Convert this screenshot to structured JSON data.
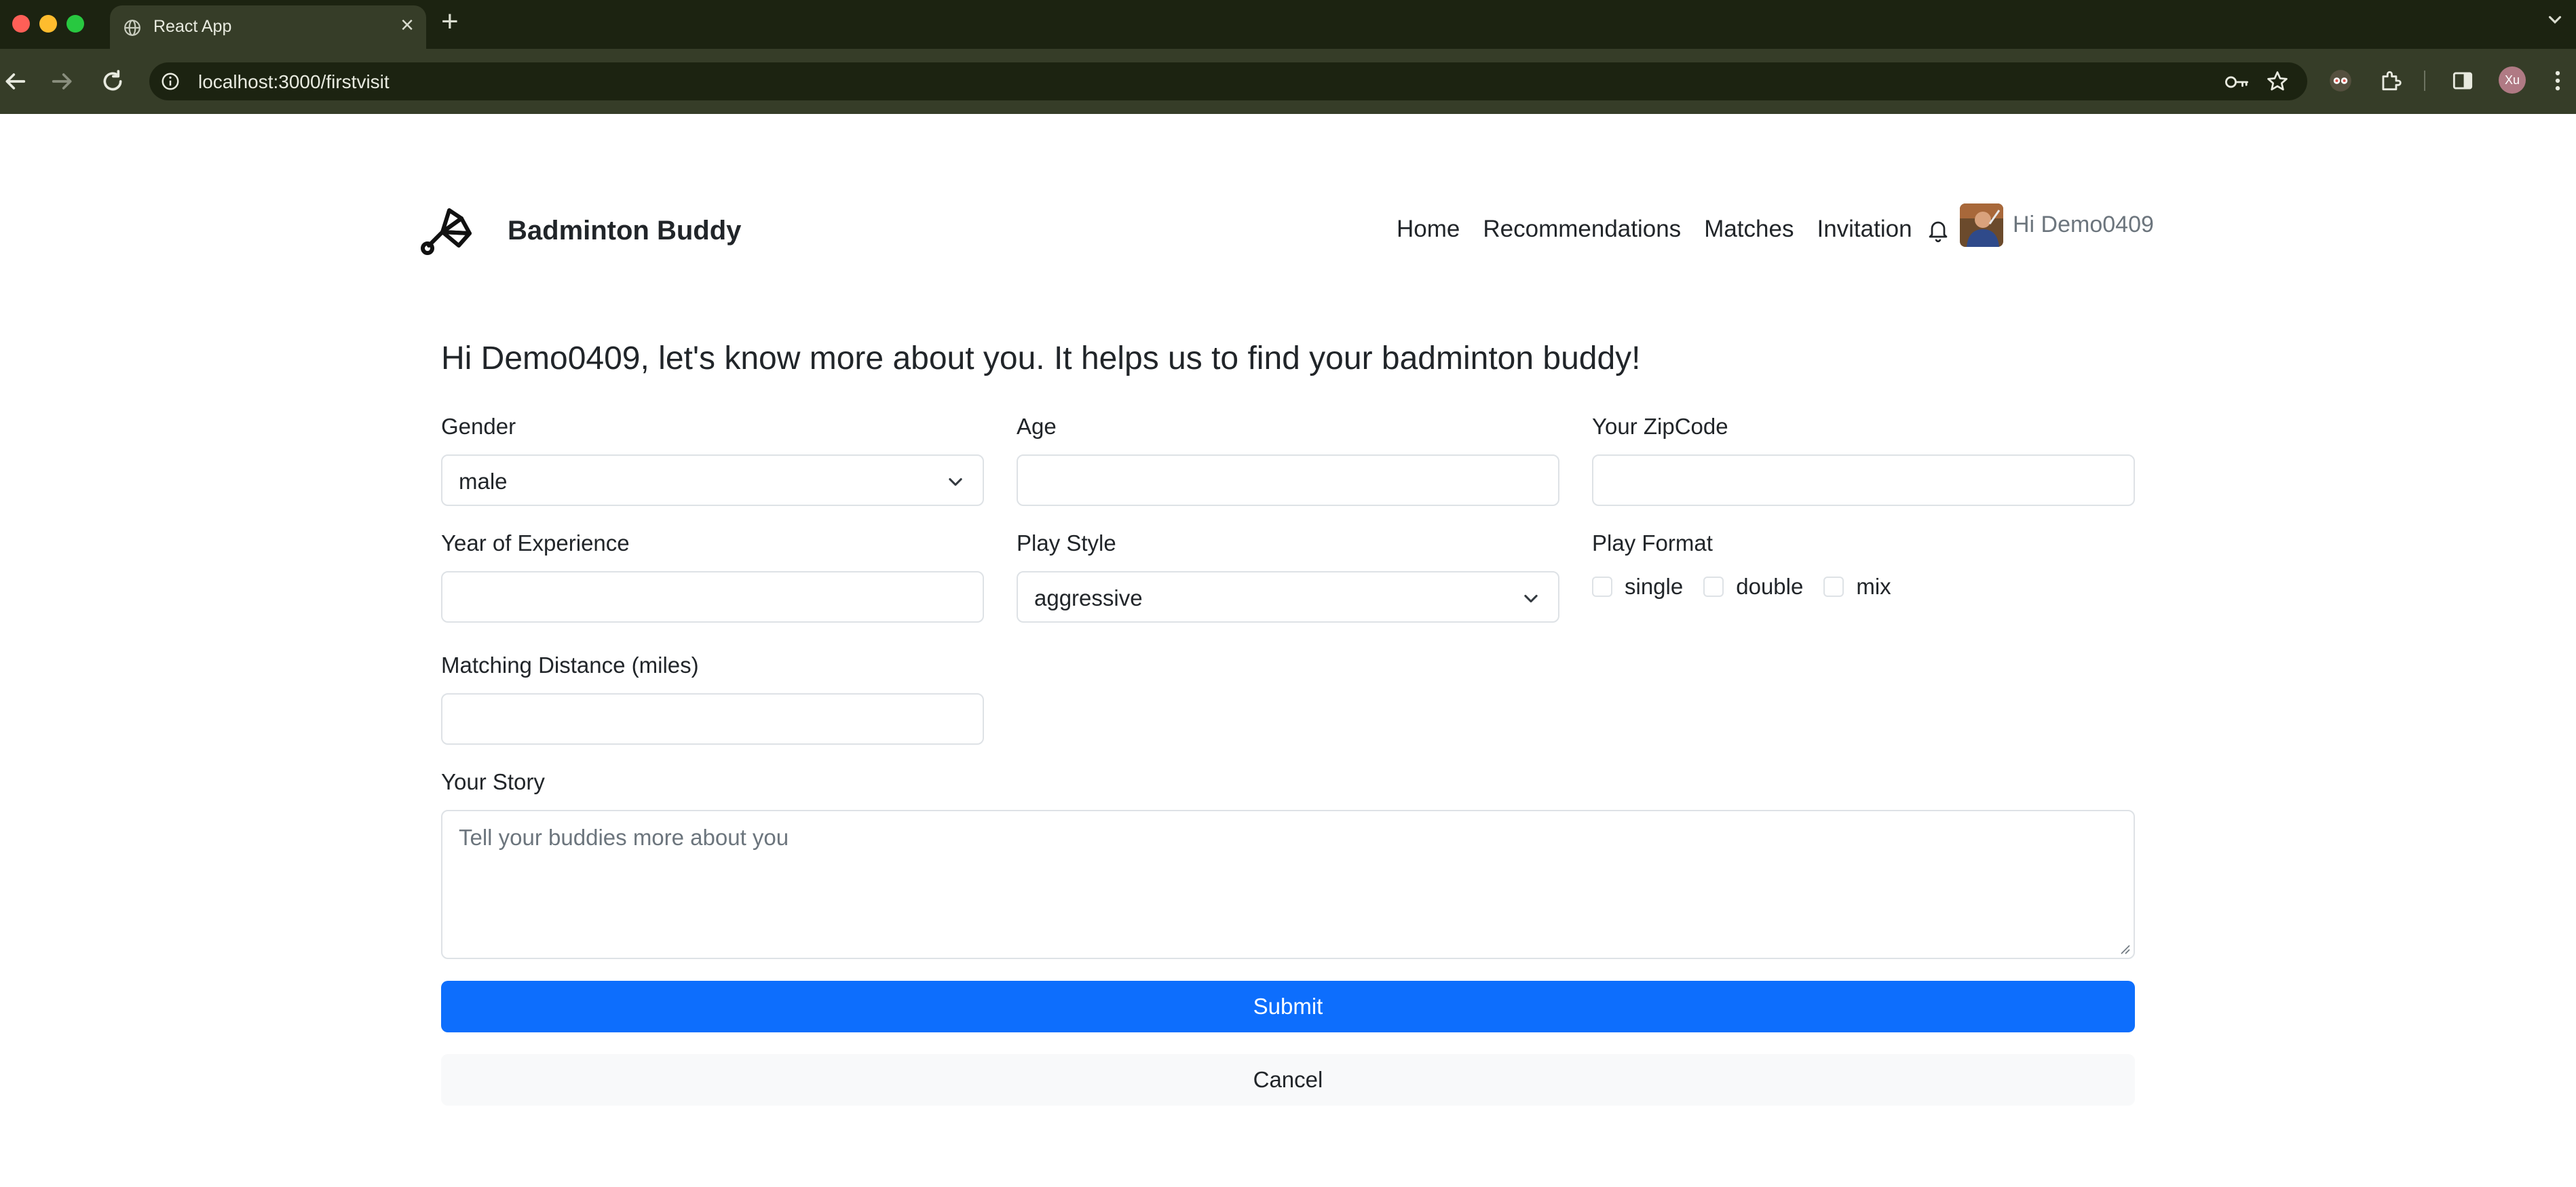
{
  "browser": {
    "tab_title": "React App",
    "url": "localhost:3000/firstvisit",
    "profile_initials": "Xu"
  },
  "navbar": {
    "brand": "Badminton Buddy",
    "links": [
      "Home",
      "Recommendations",
      "Matches",
      "Invitation"
    ],
    "greeting": "Hi Demo0409"
  },
  "form": {
    "heading": "Hi Demo0409, let's know more about you. It helps us to find your badminton buddy!",
    "gender": {
      "label": "Gender",
      "value": "male"
    },
    "age": {
      "label": "Age",
      "value": ""
    },
    "zipcode": {
      "label": "Your ZipCode",
      "value": ""
    },
    "experience": {
      "label": "Year of Experience",
      "value": ""
    },
    "play_style": {
      "label": "Play Style",
      "value": "aggressive"
    },
    "play_format": {
      "label": "Play Format",
      "options": [
        "single",
        "double",
        "mix"
      ],
      "checked": [
        false,
        false,
        false
      ]
    },
    "distance": {
      "label": "Matching Distance (miles)",
      "value": ""
    },
    "story": {
      "label": "Your Story",
      "placeholder": "Tell your buddies more about you"
    },
    "submit_label": "Submit",
    "cancel_label": "Cancel"
  },
  "colors": {
    "primary": "#0d6efd",
    "chrome_dark": "#1c2311",
    "chrome_bar": "#363d28"
  }
}
